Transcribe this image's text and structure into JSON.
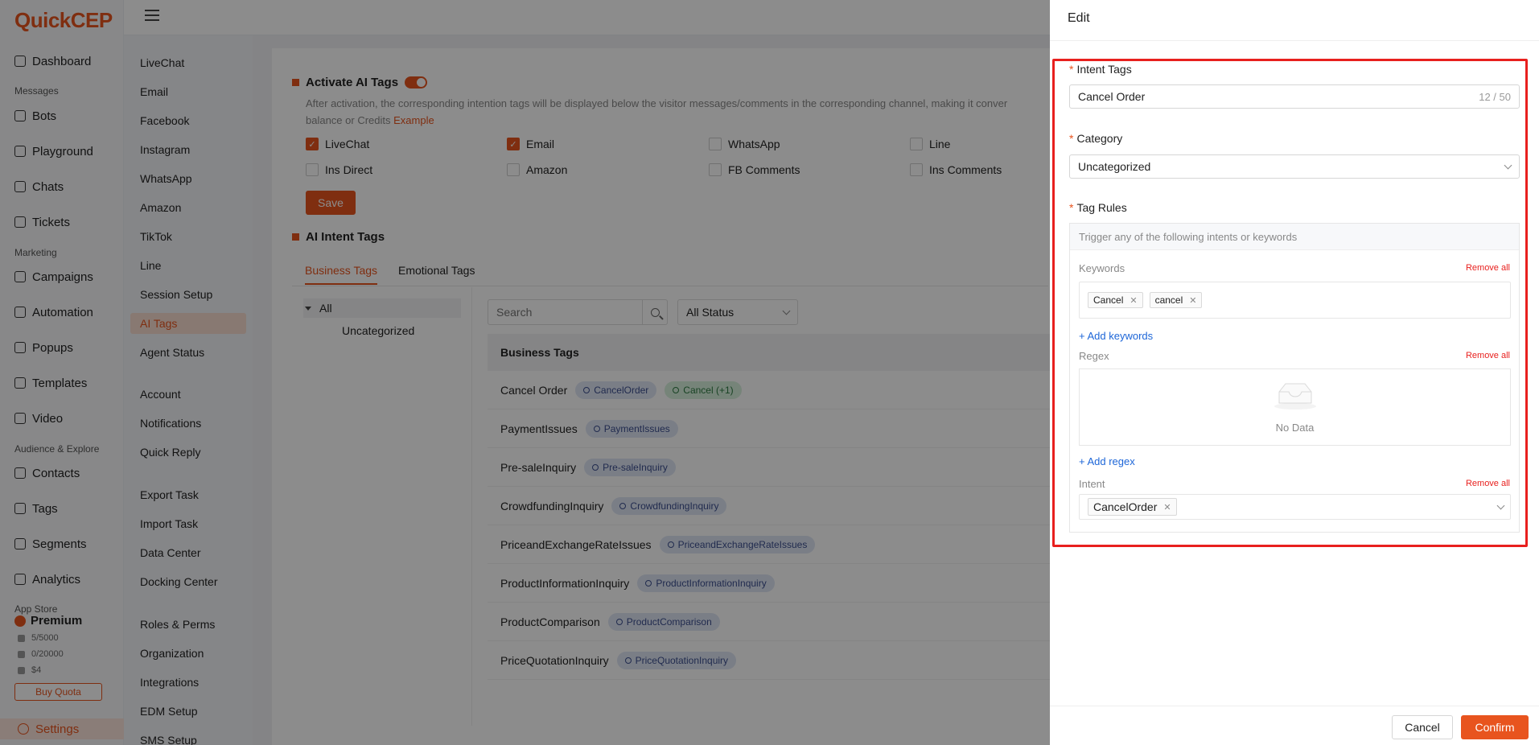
{
  "app": {
    "logo": "QuickCEP"
  },
  "nav": {
    "items": [
      {
        "label": "Dashboard",
        "icon": "home-icon"
      },
      {
        "section": "Messages"
      },
      {
        "label": "Bots",
        "icon": "bot-icon"
      },
      {
        "label": "Playground",
        "icon": "playground-icon"
      },
      {
        "label": "Chats",
        "icon": "chat-icon"
      },
      {
        "label": "Tickets",
        "icon": "ticket-icon"
      },
      {
        "section": "Marketing"
      },
      {
        "label": "Campaigns",
        "icon": "send-icon"
      },
      {
        "label": "Automation",
        "icon": "automation-icon"
      },
      {
        "label": "Popups",
        "icon": "popup-icon"
      },
      {
        "label": "Templates",
        "icon": "template-icon"
      },
      {
        "label": "Video",
        "icon": "video-icon"
      },
      {
        "section": "Audience & Explore"
      },
      {
        "label": "Contacts",
        "icon": "user-icon"
      },
      {
        "label": "Tags",
        "icon": "tag-icon"
      },
      {
        "label": "Segments",
        "icon": "users-icon"
      },
      {
        "label": "Analytics",
        "icon": "analytics-icon"
      },
      {
        "section": "App Store"
      }
    ],
    "plan": "Premium",
    "quotas": [
      "5/5000",
      "0/20000",
      "$4"
    ],
    "buy_quota": "Buy Quota",
    "settings": "Settings"
  },
  "submenu": [
    "LiveChat",
    "Email",
    "Facebook",
    "Instagram",
    "WhatsApp",
    "Amazon",
    "TikTok",
    "Line",
    "Session Setup",
    "AI Tags",
    "Agent Status",
    "Account",
    "Notifications",
    "Quick Reply",
    "Export Task",
    "Import Task",
    "Data Center",
    "Docking Center",
    "Roles & Perms",
    "Organization",
    "Integrations",
    "EDM Setup",
    "SMS Setup"
  ],
  "activate": {
    "title": "Activate AI Tags",
    "desc": "After activation, the corresponding intention tags will be displayed below the visitor messages/comments in the corresponding channel, making it conver",
    "desc2": "balance or Credits",
    "example": "Example",
    "channels": [
      {
        "label": "LiveChat",
        "checked": true
      },
      {
        "label": "Email",
        "checked": true
      },
      {
        "label": "WhatsApp",
        "checked": false
      },
      {
        "label": "Line",
        "checked": false
      },
      {
        "label": "Ins Direct",
        "checked": false
      },
      {
        "label": "Amazon",
        "checked": false
      },
      {
        "label": "FB Comments",
        "checked": false
      },
      {
        "label": "Ins Comments",
        "checked": false
      }
    ],
    "save": "Save"
  },
  "intent_section": {
    "title": "AI Intent Tags",
    "tabs": [
      "Business Tags",
      "Emotional Tags"
    ],
    "tree": {
      "root": "All",
      "child": "Uncategorized"
    },
    "search_placeholder": "Search",
    "status": "All Status",
    "table_header": "Business Tags",
    "rows": [
      {
        "name": "Cancel Order",
        "chips": [
          {
            "text": "CancelOrder",
            "color": "blue"
          },
          {
            "text": "Cancel (+1)",
            "color": "green"
          }
        ]
      },
      {
        "name": "PaymentIssues",
        "chips": [
          {
            "text": "PaymentIssues",
            "color": "blue"
          }
        ]
      },
      {
        "name": "Pre-saleInquiry",
        "chips": [
          {
            "text": "Pre-saleInquiry",
            "color": "blue"
          }
        ]
      },
      {
        "name": "CrowdfundingInquiry",
        "chips": [
          {
            "text": "CrowdfundingInquiry",
            "color": "blue"
          }
        ]
      },
      {
        "name": "PriceandExchangeRateIssues",
        "chips": [
          {
            "text": "PriceandExchangeRateIssues",
            "color": "blue"
          }
        ]
      },
      {
        "name": "ProductInformationInquiry",
        "chips": [
          {
            "text": "ProductInformationInquiry",
            "color": "blue"
          }
        ]
      },
      {
        "name": "ProductComparison",
        "chips": [
          {
            "text": "ProductComparison",
            "color": "blue"
          }
        ]
      },
      {
        "name": "PriceQuotationInquiry",
        "chips": [
          {
            "text": "PriceQuotationInquiry",
            "color": "blue"
          }
        ]
      }
    ]
  },
  "drawer": {
    "title": "Edit",
    "intent_tags_label": "Intent Tags",
    "intent_tags_value": "Cancel Order",
    "intent_tags_count": "12 / 50",
    "category_label": "Category",
    "category_value": "Uncategorized",
    "tag_rules_label": "Tag Rules",
    "rules_hint": "Trigger any of the following intents or keywords",
    "keywords_label": "Keywords",
    "remove_all": "Remove all",
    "keywords": [
      "Cancel",
      "cancel"
    ],
    "add_keywords": "+ Add keywords",
    "regex_label": "Regex",
    "no_data": "No Data",
    "add_regex": "+ Add regex",
    "intent_label": "Intent",
    "intent_values": [
      "CancelOrder"
    ],
    "cancel": "Cancel",
    "confirm": "Confirm"
  },
  "colors": {
    "accent": "#e8541e",
    "highlight_box": "#e8201e",
    "link": "#1d66d8"
  }
}
